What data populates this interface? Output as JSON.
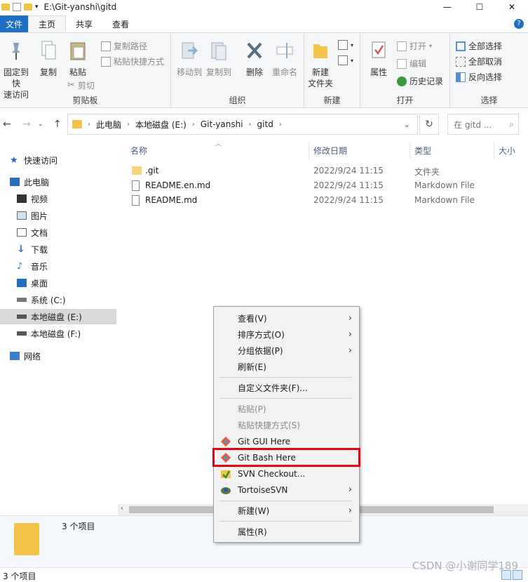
{
  "window": {
    "title_path": "E:\\Git-yanshi\\gitd",
    "buttons": [
      "—",
      "☐",
      "✕"
    ]
  },
  "ribbon_tabs": [
    "文件",
    "主页",
    "共享",
    "查看"
  ],
  "ribbon": {
    "clipboard": {
      "pin_label_1": "固定到快",
      "pin_label_2": "速访问",
      "copy": "复制",
      "paste": "粘贴",
      "copy_path": "复制路径",
      "paste_shortcut": "粘贴快捷方式",
      "cut": "剪切",
      "group": "剪贴板"
    },
    "organize": {
      "move_to": "移动到",
      "copy_to": "复制到",
      "delete": "删除",
      "rename": "重命名",
      "group": "组织"
    },
    "new": {
      "new_folder_1": "新建",
      "new_folder_2": "文件夹",
      "group": "新建"
    },
    "open": {
      "properties": "属性",
      "open": "打开",
      "edit": "编辑",
      "history": "历史记录",
      "group": "打开"
    },
    "select": {
      "select_all": "全部选择",
      "select_none": "全部取消",
      "invert": "反向选择",
      "group": "选择"
    }
  },
  "address": {
    "crumbs": [
      "此电脑",
      "本地磁盘 (E:)",
      "Git-yanshi",
      "gitd"
    ],
    "search_placeholder": "在 gitd ..."
  },
  "nav_pane": [
    {
      "label": "快速访问",
      "icon": "star-icon"
    },
    {
      "label": "此电脑",
      "icon": "computer-icon"
    },
    {
      "label": "视频",
      "icon": "video-icon"
    },
    {
      "label": "图片",
      "icon": "picture-icon"
    },
    {
      "label": "文档",
      "icon": "document-icon"
    },
    {
      "label": "下载",
      "icon": "download-icon"
    },
    {
      "label": "音乐",
      "icon": "music-icon"
    },
    {
      "label": "桌面",
      "icon": "desktop-icon"
    },
    {
      "label": "系统 (C:)",
      "icon": "drive-icon"
    },
    {
      "label": "本地磁盘 (E:)",
      "icon": "drive-icon"
    },
    {
      "label": "本地磁盘 (F:)",
      "icon": "drive-icon"
    },
    {
      "label": "网络",
      "icon": "network-icon"
    }
  ],
  "columns": [
    "名称",
    "修改日期",
    "类型",
    "大小"
  ],
  "files": [
    {
      "name": ".git",
      "modified": "2022/9/24 11:15",
      "type": "文件夹"
    },
    {
      "name": "README.en.md",
      "modified": "2022/9/24 11:15",
      "type": "Markdown File"
    },
    {
      "name": "README.md",
      "modified": "2022/9/24 11:15",
      "type": "Markdown File"
    }
  ],
  "context_menu": {
    "view": "查看(V)",
    "sort": "排序方式(O)",
    "group": "分组依据(P)",
    "refresh": "刷新(E)",
    "customize": "自定义文件夹(F)...",
    "paste": "粘贴(P)",
    "paste_shortcut": "粘贴快捷方式(S)",
    "git_gui": "Git GUI Here",
    "git_bash": "Git Bash Here",
    "svn_checkout": "SVN Checkout...",
    "tortoise": "TortoiseSVN",
    "new": "新建(W)",
    "properties": "属性(R)"
  },
  "details": {
    "count": "3 个项目"
  },
  "status": {
    "count": "3 个项目"
  },
  "watermark": "CSDN @小谢同学189",
  "colors": {
    "accent": "#1f6fc2",
    "highlight": "#e60012",
    "folder": "#f3c447"
  }
}
